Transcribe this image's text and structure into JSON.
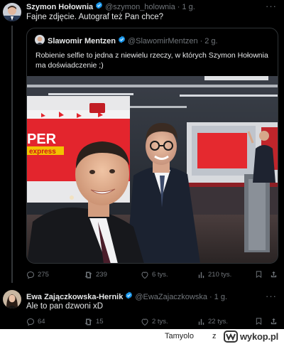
{
  "post": {
    "author_name": "Szymon Hołownia",
    "author_handle": "@szymon_holownia",
    "separator": "·",
    "time": "1 g.",
    "text": "Fajne zdjęcie. Autograf też Pan chce?",
    "quote": {
      "author_name": "Slawomir Mentzen",
      "author_handle": "@SlawomirMentzen",
      "separator": "·",
      "time": "2 g.",
      "text": "Robienie selfie to jedna z niewielu rzeczy, w których Szymon Hołownia ma doświadczenie ;)",
      "photo": {
        "backdrop_logo_line1": "PER",
        "backdrop_logo_line2": "express"
      }
    },
    "stats": {
      "replies": "275",
      "reposts": "239",
      "likes": "6 tys.",
      "views": "210 tys."
    }
  },
  "reply": {
    "author_name": "Ewa Zajączkowska-Hernik",
    "author_handle": "@EwaZajaczkowska",
    "separator": "·",
    "time": "1 g.",
    "text": "Ale to pan dzwoni xD",
    "stats": {
      "replies": "64",
      "reposts": "15",
      "likes": "2 tys.",
      "views": "22 tys."
    }
  },
  "watermark": {
    "user": "Tamyolo",
    "connector": "z",
    "site": "wykop.pl"
  },
  "colors": {
    "background": "#000000",
    "text_primary": "#e7e9ea",
    "text_secondary": "#71767b",
    "verified_badge": "#1d9bf0",
    "border": "#2f3336"
  },
  "icons": {
    "verified": "verified-badge-icon",
    "more": "more-icon",
    "reply": "reply-icon",
    "repost": "repost-icon",
    "like": "heart-icon",
    "views": "views-icon",
    "bookmark": "bookmark-icon",
    "share": "share-icon"
  }
}
